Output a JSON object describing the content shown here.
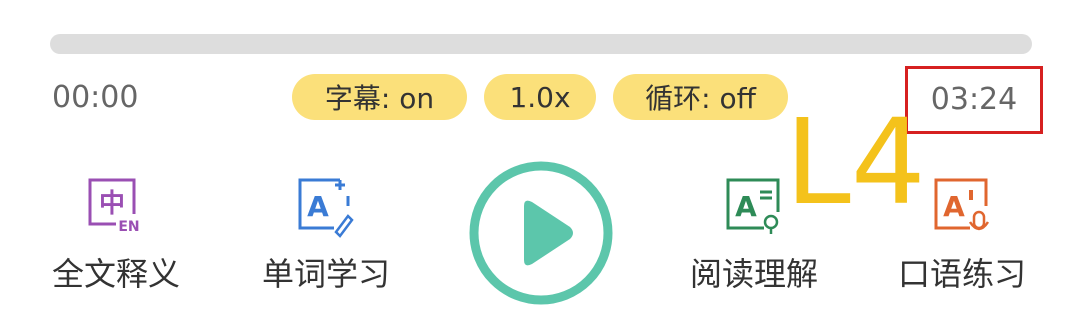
{
  "player": {
    "current_time": "00:00",
    "total_time": "03:24",
    "progress": 0,
    "subtitle_toggle": "字幕: on",
    "speed": "1.0x",
    "loop_toggle": "循环: off",
    "overlay_label": "L4"
  },
  "tools": [
    {
      "label": "全文释义",
      "icon": "chinese-english-translation-icon"
    },
    {
      "label": "单词学习",
      "icon": "word-plus-icon"
    },
    {
      "label": "阅读理解",
      "icon": "reading-bulb-icon"
    },
    {
      "label": "口语练习",
      "icon": "speaking-mic-icon"
    }
  ],
  "icon_text": {
    "zh": "中",
    "en": "EN",
    "a": "A"
  },
  "colors": {
    "accent_green": "#5cc6ab",
    "pill_yellow": "#fbe07a",
    "highlight_red": "#d62020",
    "overlay_yellow": "#f4c21b",
    "icon_purple": "#9a4fb3",
    "icon_blue": "#3a7bd5",
    "icon_green": "#2e8b57",
    "icon_orange": "#e0662f"
  }
}
